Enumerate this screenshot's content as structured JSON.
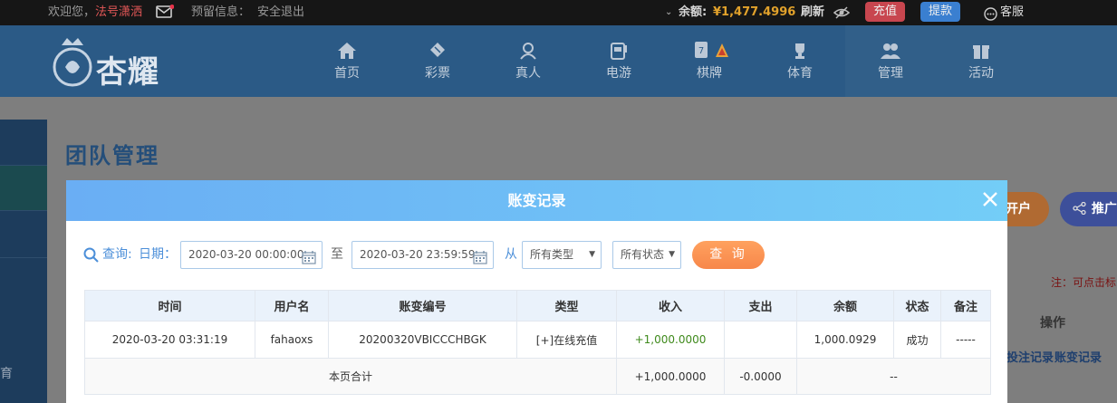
{
  "topbar": {
    "welcome": "欢迎您，",
    "username": "法号潇洒",
    "reserved_label": "预留信息：",
    "logout": "安全退出",
    "balance_label": "余额:",
    "balance": "¥1,477.4996",
    "refresh": "刷新",
    "deposit": "充值",
    "withdraw": "提款",
    "support": "客服"
  },
  "header": {
    "logo_text": "杏耀",
    "nav": [
      {
        "label": "首页",
        "icon": "home-icon"
      },
      {
        "label": "彩票",
        "icon": "ticket-icon"
      },
      {
        "label": "真人",
        "icon": "live-dealer-icon"
      },
      {
        "label": "电游",
        "icon": "slot-machine-icon"
      },
      {
        "label": "棋牌",
        "icon": "cards-icon"
      },
      {
        "label": "体育",
        "icon": "trophy-icon"
      },
      {
        "label": "管理",
        "icon": "team-icon"
      },
      {
        "label": "活动",
        "icon": "gift-icon"
      }
    ]
  },
  "background": {
    "page_title": "团队管理",
    "sidebar_text": "育",
    "open_account": "开户",
    "promote": "推广",
    "note": "注：可点击标",
    "col_action": "操作",
    "link_bet": "投注记录",
    "link_account": "账变记录"
  },
  "modal": {
    "title": "账变记录",
    "query_label": "查询:",
    "date_label": "日期：",
    "start_date": "2020-03-20 00:00:00",
    "to_label": "至",
    "end_date": "2020-03-20 23:59:59",
    "from_label": "从",
    "type_select": "所有类型",
    "status_select": "所有状态",
    "query_button": "查 询",
    "columns": [
      "时间",
      "用户名",
      "账变编号",
      "类型",
      "收入",
      "支出",
      "余额",
      "状态",
      "备注"
    ],
    "rows": [
      {
        "time": "2020-03-20 03:31:19",
        "user": "fahaoxs",
        "id": "20200320VBICCCHBGK",
        "type": "[+]在线充值",
        "income": "+1,000.0000",
        "expense": "",
        "balance": "1,000.0929",
        "status": "成功",
        "remark": "-----"
      }
    ],
    "summary": {
      "label": "本页合计",
      "income": "+1,000.0000",
      "expense": "-0.0000",
      "rest": "--"
    }
  },
  "colors": {
    "topbar_bg": "#161616",
    "header_bg": "#2b5a86",
    "modal_head_start": "#6aaef4",
    "modal_head_end": "#73cdf7",
    "query_button": "#f7874a",
    "deposit_button": "#c8464f",
    "withdraw_button": "#3a7fd0",
    "income_green": "#3f8a1c"
  }
}
